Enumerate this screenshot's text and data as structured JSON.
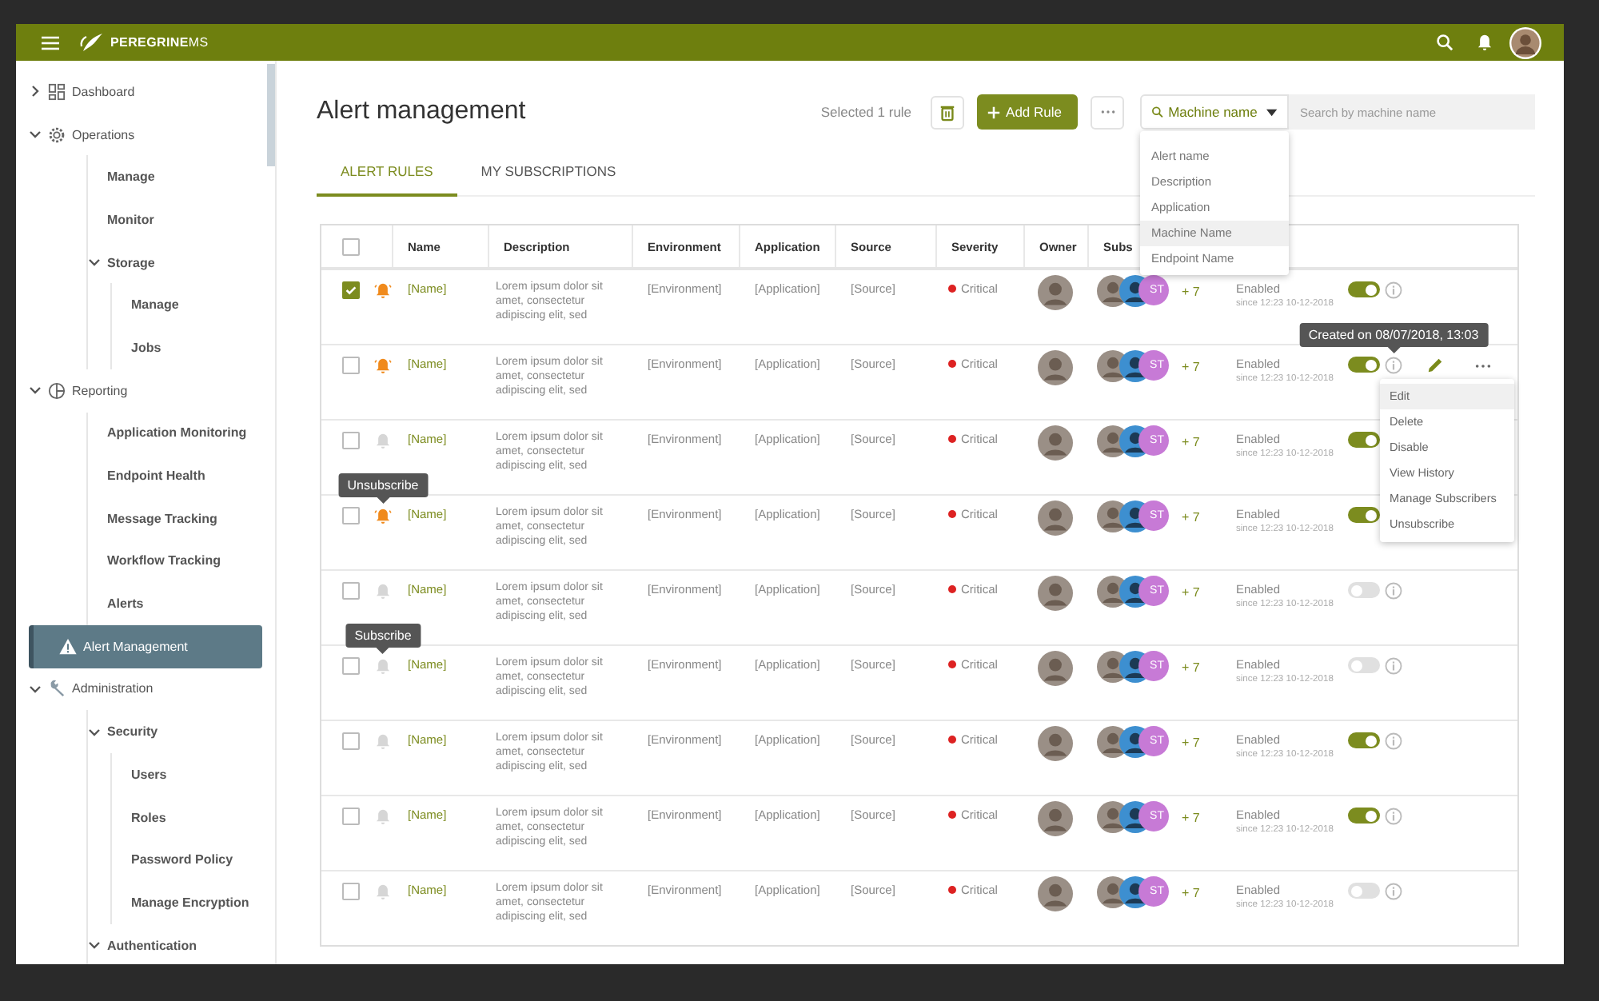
{
  "topbar": {
    "brand": "**PEREGRINE**MS"
  },
  "sidebar": {
    "items": [
      {
        "label": "Dashboard",
        "expanded": false,
        "selected": false
      },
      {
        "label": "Operations",
        "expanded": true,
        "selected": false,
        "children": [
          {
            "label": "Manage",
            "selected": false
          },
          {
            "label": "Monitor",
            "selected": false
          },
          {
            "label": "Storage",
            "expanded": true,
            "selected": false,
            "children": [
              {
                "label": "Manage",
                "selected": false
              },
              {
                "label": "Jobs",
                "selected": false
              }
            ]
          }
        ]
      },
      {
        "label": "Reporting",
        "expanded": true,
        "selected": false,
        "children": [
          {
            "label": "Application Monitoring",
            "selected": false
          },
          {
            "label": "Endpoint Health",
            "selected": false
          },
          {
            "label": "Message Tracking",
            "selected": false
          },
          {
            "label": "Workflow Tracking",
            "selected": false
          },
          {
            "label": "Alerts",
            "selected": false
          }
        ]
      },
      {
        "label": "Alert Management",
        "selected": true
      },
      {
        "label": "Administration",
        "expanded": true,
        "selected": false,
        "children": [
          {
            "label": "Security",
            "expanded": true,
            "selected": false,
            "children": [
              {
                "label": "Users",
                "selected": false
              },
              {
                "label": "Roles",
                "selected": false
              },
              {
                "label": "Password Policy",
                "selected": false
              },
              {
                "label": "Manage Encryption",
                "selected": false
              }
            ]
          },
          {
            "label": "Authentication",
            "expanded": true,
            "selected": false
          }
        ]
      }
    ]
  },
  "page": {
    "title": "Alert management"
  },
  "toolbar": {
    "selection_text": "Selected 1 rule",
    "add_button": "Add Rule",
    "search": {
      "field": "Machine name",
      "placeholder": "Search by machine name",
      "open": true,
      "options": [
        {
          "label": "Alert name",
          "selected": false
        },
        {
          "label": "Description",
          "selected": false
        },
        {
          "label": "Application",
          "selected": false
        },
        {
          "label": "Machine Name",
          "selected": true
        },
        {
          "label": "Endpoint Name",
          "selected": false
        }
      ]
    }
  },
  "tabs": [
    {
      "label": "ALERT RULES",
      "selected": true
    },
    {
      "label": "MY SUBSCRIPTIONS",
      "selected": false
    }
  ],
  "table": {
    "header_checked": false,
    "columns": [
      "Name",
      "Description",
      "Environment",
      "Application",
      "Source",
      "Severity",
      "Owner",
      "Subs"
    ],
    "rows": [
      {
        "checked": true,
        "subscribed": true,
        "name": "[Name]",
        "description": [
          "Lorem ipsum dolor sit",
          "amet, consectetur",
          "adipiscing elit, sed"
        ],
        "environment": "[Environment]",
        "application": "[Application]",
        "source": "[Source]",
        "severity": "Critical",
        "subscriber_initials": "ST",
        "extra_subscribers": "+ 7",
        "status": "Enabled",
        "since": "since 12:23 10-12-2018",
        "on": true
      },
      {
        "checked": false,
        "subscribed": true,
        "name": "[Name]",
        "description": [
          "Lorem ipsum dolor sit",
          "amet, consectetur",
          "adipiscing elit, sed"
        ],
        "environment": "[Environment]",
        "application": "[Application]",
        "source": "[Source]",
        "severity": "Critical",
        "subscriber_initials": "ST",
        "extra_subscribers": "+ 7",
        "status": "Enabled",
        "since": "since 12:23 10-12-2018",
        "on": true,
        "info_tooltip": "Created on 08/07/2018, 13:03",
        "actions_shown": true,
        "menu": [
          {
            "label": "Edit",
            "selected": true
          },
          {
            "label": "Delete",
            "selected": false
          },
          {
            "label": "Disable",
            "selected": false
          },
          {
            "label": "View History",
            "selected": false
          },
          {
            "label": "Manage Subscribers",
            "selected": false
          },
          {
            "label": "Unsubscribe",
            "selected": false
          }
        ]
      },
      {
        "checked": false,
        "subscribed": false,
        "name": "[Name]",
        "description": [
          "Lorem ipsum dolor sit",
          "amet, consectetur",
          "adipiscing elit, sed"
        ],
        "environment": "[Environment]",
        "application": "[Application]",
        "source": "[Source]",
        "severity": "Critical",
        "subscriber_initials": "ST",
        "extra_subscribers": "+ 7",
        "status": "Enabled",
        "since": "since 12:23 10-12-2018",
        "on": true
      },
      {
        "checked": false,
        "subscribed": true,
        "bell_tooltip": "Unsubscribe",
        "name": "[Name]",
        "description": [
          "Lorem ipsum dolor sit",
          "amet, consectetur",
          "adipiscing elit, sed"
        ],
        "environment": "[Environment]",
        "application": "[Application]",
        "source": "[Source]",
        "severity": "Critical",
        "subscriber_initials": "ST",
        "extra_subscribers": "+ 7",
        "status": "Enabled",
        "since": "since 12:23 10-12-2018",
        "on": true
      },
      {
        "checked": false,
        "subscribed": false,
        "name": "[Name]",
        "description": [
          "Lorem ipsum dolor sit",
          "amet, consectetur",
          "adipiscing elit, sed"
        ],
        "environment": "[Environment]",
        "application": "[Application]",
        "source": "[Source]",
        "severity": "Critical",
        "subscriber_initials": "ST",
        "extra_subscribers": "+ 7",
        "status": "Enabled",
        "since": "since 12:23 10-12-2018",
        "on": false
      },
      {
        "checked": false,
        "subscribed": false,
        "bell_tooltip": "Subscribe",
        "name": "[Name]",
        "description": [
          "Lorem ipsum dolor sit",
          "amet, consectetur",
          "adipiscing elit, sed"
        ],
        "environment": "[Environment]",
        "application": "[Application]",
        "source": "[Source]",
        "severity": "Critical",
        "subscriber_initials": "ST",
        "extra_subscribers": "+ 7",
        "status": "Enabled",
        "since": "since 12:23 10-12-2018",
        "on": false
      },
      {
        "checked": false,
        "subscribed": false,
        "name": "[Name]",
        "description": [
          "Lorem ipsum dolor sit",
          "amet, consectetur",
          "adipiscing elit, sed"
        ],
        "environment": "[Environment]",
        "application": "[Application]",
        "source": "[Source]",
        "severity": "Critical",
        "subscriber_initials": "ST",
        "extra_subscribers": "+ 7",
        "status": "Enabled",
        "since": "since 12:23 10-12-2018",
        "on": true
      },
      {
        "checked": false,
        "subscribed": false,
        "name": "[Name]",
        "description": [
          "Lorem ipsum dolor sit",
          "amet, consectetur",
          "adipiscing elit, sed"
        ],
        "environment": "[Environment]",
        "application": "[Application]",
        "source": "[Source]",
        "severity": "Critical",
        "subscriber_initials": "ST",
        "extra_subscribers": "+ 7",
        "status": "Enabled",
        "since": "since 12:23 10-12-2018",
        "on": true
      },
      {
        "checked": false,
        "subscribed": false,
        "name": "[Name]",
        "description": [
          "Lorem ipsum dolor sit",
          "amet, consectetur",
          "adipiscing elit, sed"
        ],
        "environment": "[Environment]",
        "application": "[Application]",
        "source": "[Source]",
        "severity": "Critical",
        "subscriber_initials": "ST",
        "extra_subscribers": "+ 7",
        "status": "Enabled",
        "since": "since 12:23 10-12-2018",
        "on": false
      }
    ]
  }
}
